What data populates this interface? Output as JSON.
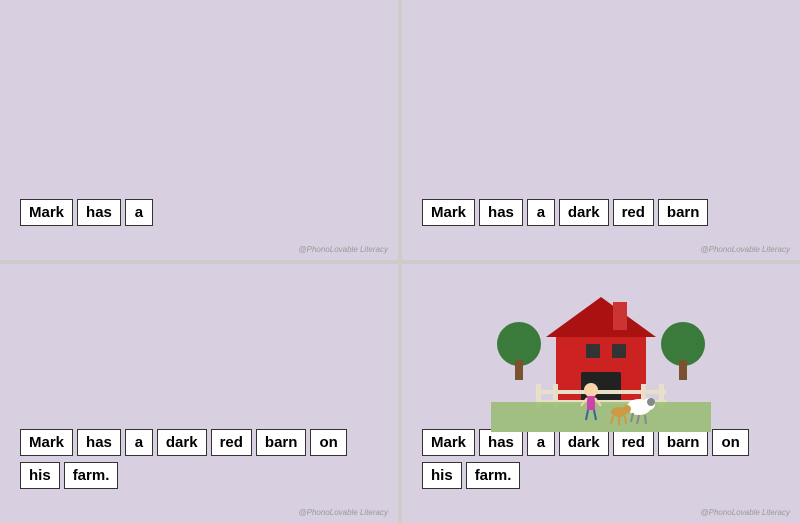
{
  "cards": [
    {
      "id": "card1",
      "rows": [
        [
          "Mark",
          "has",
          "a"
        ]
      ],
      "watermark": "@PhonoLovable Literacy",
      "hasIllustration": false
    },
    {
      "id": "card2",
      "rows": [
        [
          "Mark",
          "has",
          "a",
          "dark",
          "red",
          "barn"
        ]
      ],
      "watermark": "@PhonoLovable Literacy",
      "hasIllustration": false
    },
    {
      "id": "card3",
      "rows": [
        [
          "Mark",
          "has",
          "a",
          "dark",
          "red",
          "barn",
          "on"
        ],
        [
          "his",
          "farm."
        ]
      ],
      "watermark": "@PhonoLovable Literacy",
      "hasIllustration": false
    },
    {
      "id": "card4",
      "rows": [
        [
          "Mark",
          "has",
          "a",
          "dark",
          "red",
          "barn",
          "on"
        ],
        [
          "his",
          "farm."
        ]
      ],
      "watermark": "@PhonoLovable Literacy",
      "hasIllustration": true
    }
  ]
}
